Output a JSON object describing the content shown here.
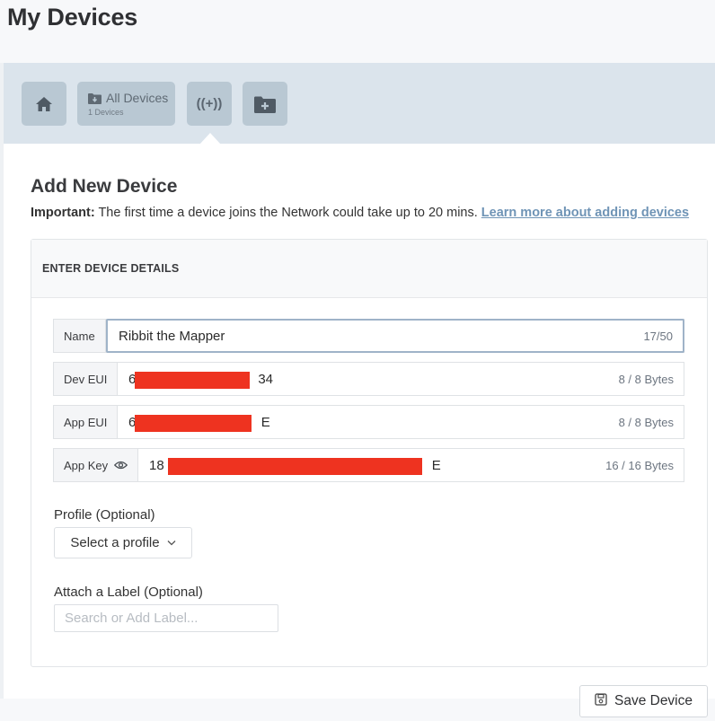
{
  "page": {
    "title": "My Devices"
  },
  "nav": {
    "home_icon": "home-icon",
    "all_devices": {
      "label": "All Devices",
      "sub": "1 Devices",
      "icon": "folder-download-icon"
    },
    "signal": {
      "label": "((+))",
      "icon": "broadcast-icon"
    },
    "add_folder_icon": "folder-plus-icon"
  },
  "section": {
    "title": "Add New Device",
    "important_label": "Important:",
    "important_text": " The first time a device joins the Network could take up to 20 mins. ",
    "learn_more": "Learn more about adding devices"
  },
  "card": {
    "header": "ENTER DEVICE DETAILS",
    "fields": {
      "name": {
        "label": "Name",
        "value": "Ribbit the Mapper",
        "count": "17/50"
      },
      "dev_eui": {
        "label": "Dev EUI",
        "prefix": "6",
        "suffix": "34",
        "count": "8 / 8 Bytes"
      },
      "app_eui": {
        "label": "App EUI",
        "prefix": "60",
        "suffix": "E",
        "count": "8 / 8 Bytes"
      },
      "app_key": {
        "label": "App Key",
        "prefix": "18",
        "suffix": "E",
        "count": "16 / 16 Bytes",
        "icon": "eye-icon"
      }
    },
    "profile": {
      "label": "Profile (Optional)",
      "selected": "Select a profile",
      "chevron": "chevron-down-icon"
    },
    "attach_label": {
      "label": "Attach a Label (Optional)",
      "placeholder": "Search or Add Label..."
    }
  },
  "footer": {
    "save_label": "Save Device",
    "save_icon": "save-icon"
  },
  "colors": {
    "redaction": "#ee3320",
    "nav_band": "#dbe4ec",
    "nav_button": "#b9c8d3",
    "link": "#6f94b6"
  }
}
